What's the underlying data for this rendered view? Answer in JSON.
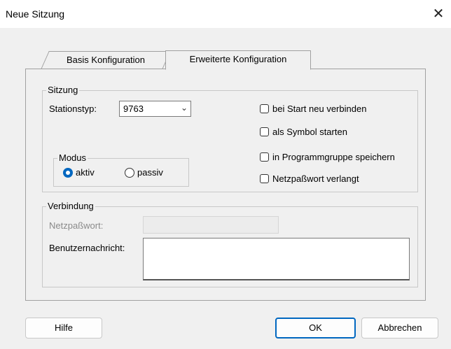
{
  "window": {
    "title": "Neue Sitzung",
    "close_glyph": "✕"
  },
  "tabs": [
    {
      "label": "Basis Konfiguration"
    },
    {
      "label": "Erweiterte Konfiguration"
    }
  ],
  "sitzung": {
    "group_label": "Sitzung",
    "stationstyp_label": "Stationstyp:",
    "stationstyp_value": "9763",
    "checkboxes": [
      {
        "label": "bei Start neu verbinden",
        "checked": false
      },
      {
        "label": "als Symbol starten",
        "checked": false
      },
      {
        "label": "in Programmgruppe speichern",
        "checked": false
      },
      {
        "label": "Netzpaßwort verlangt",
        "checked": false
      }
    ],
    "modus": {
      "group_label": "Modus",
      "options": [
        {
          "label": "aktiv",
          "selected": true
        },
        {
          "label": "passiv",
          "selected": false
        }
      ]
    }
  },
  "verbindung": {
    "group_label": "Verbindung",
    "netzpasswort_label": "Netzpaßwort:",
    "netzpasswort_value": "",
    "benutzernachricht_label": "Benutzernachricht:",
    "benutzernachricht_value": ""
  },
  "buttons": {
    "help": "Hilfe",
    "ok": "OK",
    "cancel": "Abbrechen"
  },
  "colors": {
    "accent": "#0067c0"
  }
}
